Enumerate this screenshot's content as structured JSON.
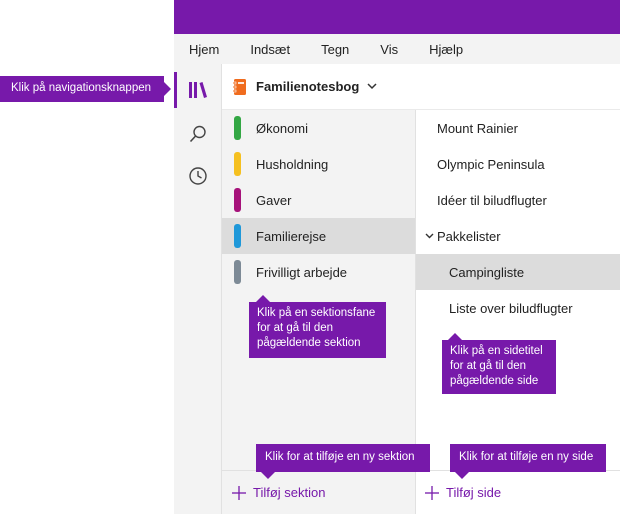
{
  "ribbon": {
    "tabs": [
      "Hjem",
      "Indsæt",
      "Tegn",
      "Vis",
      "Hjælp"
    ]
  },
  "notebook": {
    "title": "Familienotesbog",
    "icon": "notebook-icon",
    "color": "#F06C1E"
  },
  "left_rail": {
    "items": [
      {
        "icon": "notebooks-icon",
        "active": true
      },
      {
        "icon": "search-icon",
        "active": false
      },
      {
        "icon": "recent-icon",
        "active": false
      }
    ]
  },
  "sections": [
    {
      "label": "Økonomi",
      "color": "#33A744"
    },
    {
      "label": "Husholdning",
      "color": "#F5C020"
    },
    {
      "label": "Gaver",
      "color": "#A6127A"
    },
    {
      "label": "Familierejse",
      "color": "#1F98D9",
      "selected": true
    },
    {
      "label": "Frivilligt arbejde",
      "color": "#7D8A96"
    }
  ],
  "pages": [
    {
      "label": "Mount Rainier",
      "level": 0
    },
    {
      "label": "Olympic Peninsula",
      "level": 0
    },
    {
      "label": "Idéer til biludflugter",
      "level": 0
    },
    {
      "label": "Pakkelister",
      "level": 0,
      "expanded": true
    },
    {
      "label": "Campingliste",
      "level": 1,
      "selected": true
    },
    {
      "label": "Liste over biludflugter",
      "level": 1
    }
  ],
  "bottom": {
    "add_section": "Tilføj sektion",
    "add_page": "Tilføj side"
  },
  "callouts": {
    "nav": "Klik på navigationsknappen",
    "section": "Klik på en sektionsfane for at gå til den pågældende sektion",
    "page": "Klik på en sidetitel for at gå til den pågældende side",
    "add_section": "Klik for at tilføje en ny sektion",
    "add_page": "Klik for at tilføje en ny side"
  },
  "colors": {
    "accent": "#7719AA",
    "rail_background": "#F3F3F3",
    "selection": "#DCDCDC"
  }
}
